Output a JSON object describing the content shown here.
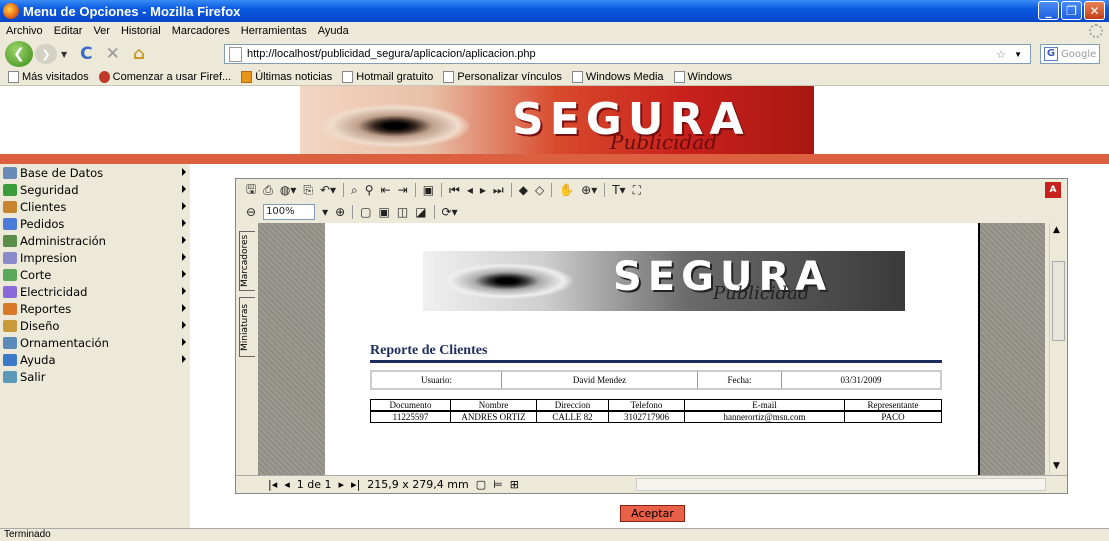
{
  "window": {
    "title": "Menu de Opciones - Mozilla Firefox"
  },
  "menubar": {
    "items": [
      "Archivo",
      "Editar",
      "Ver",
      "Historial",
      "Marcadores",
      "Herramientas",
      "Ayuda"
    ]
  },
  "nav": {
    "url": "http://localhost/publicidad_segura/aplicacion/aplicacion.php",
    "search_placeholder": "Google"
  },
  "bookmarks": [
    "Más visitados",
    "Comenzar a usar Firef...",
    "Últimas noticias",
    "Hotmail gratuito",
    "Personalizar vínculos",
    "Windows Media",
    "Windows"
  ],
  "banner": {
    "word": "SEGURA",
    "sub": "Publicidad"
  },
  "sidebar": {
    "items": [
      {
        "label": "Base de Datos",
        "color": "#6a8ab8",
        "arrow": true
      },
      {
        "label": "Seguridad",
        "color": "#3a9c3a",
        "arrow": true
      },
      {
        "label": "Clientes",
        "color": "#c8842c",
        "arrow": true
      },
      {
        "label": "Pedidos",
        "color": "#4a7ad8",
        "arrow": true
      },
      {
        "label": "Administración",
        "color": "#5a8c4a",
        "arrow": true
      },
      {
        "label": "Impresion",
        "color": "#8a8ac8",
        "arrow": true
      },
      {
        "label": "Corte",
        "color": "#5aa85a",
        "arrow": true
      },
      {
        "label": "Electricidad",
        "color": "#8a6ad8",
        "arrow": true
      },
      {
        "label": "Reportes",
        "color": "#d87a2a",
        "arrow": true
      },
      {
        "label": "Diseño",
        "color": "#c89a3a",
        "arrow": true
      },
      {
        "label": "Ornamentación",
        "color": "#5a8ab8",
        "arrow": true
      },
      {
        "label": "Ayuda",
        "color": "#3a7ac8",
        "arrow": true
      },
      {
        "label": "Salir",
        "color": "#5a9ab8",
        "arrow": false
      }
    ]
  },
  "pdf": {
    "zoom": "100%",
    "tabs": [
      "Marcadores",
      "Miniaturas"
    ],
    "page_indicator": "1 de 1",
    "page_size": "215,9 x 279,4 mm",
    "report": {
      "title": "Reporte de Clientes",
      "usuario_label": "Usuario:",
      "usuario_value": "David Mendez",
      "fecha_label": "Fecha:",
      "fecha_value": "03/31/2009",
      "headers": [
        "Documento",
        "Nombre",
        "Direccion",
        "Telefono",
        "E-mail",
        "Representante"
      ],
      "rows": [
        [
          "11225597",
          "ANDRES ORTIZ",
          "CALLE 82",
          "3102717906",
          "hannerortiz@msn.com",
          "PACO"
        ]
      ]
    }
  },
  "button": {
    "aceptar": "Aceptar"
  },
  "status": "Terminado"
}
